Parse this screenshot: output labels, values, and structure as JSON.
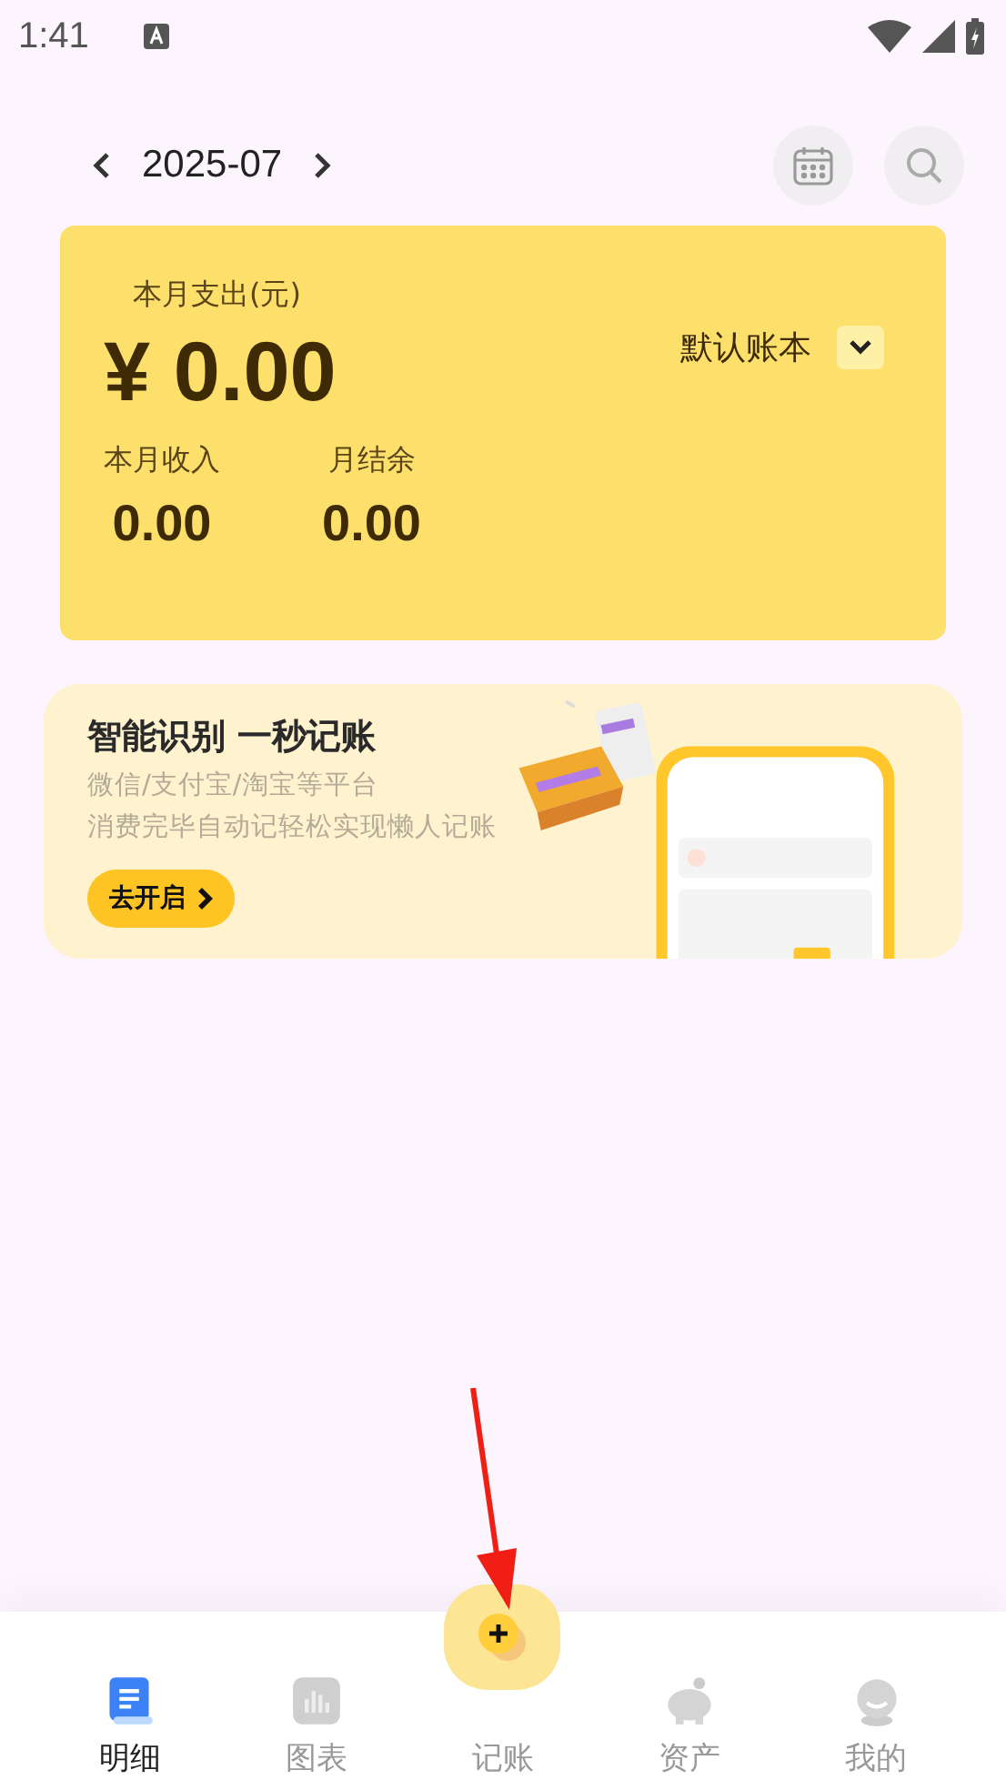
{
  "status_bar": {
    "time": "1:41"
  },
  "header": {
    "month": "2025-07"
  },
  "summary_card": {
    "expense_label": "本月支出(元)",
    "expense": "¥ 0.00",
    "book": "默认账本",
    "income_label": "本月收入",
    "income": "0.00",
    "balance_label": "月结余",
    "balance": "0.00"
  },
  "banner": {
    "title": "智能识别 一秒记账",
    "line_1": "微信/支付宝/淘宝等平台",
    "line_2": "消费完毕自动记轻松实现懒人记账",
    "button": "去开启",
    "kind": "picture"
  },
  "bottom_nav": [
    {
      "label": "明细",
      "kind": "list",
      "selected": true
    },
    {
      "label": "图表",
      "kind": "chart",
      "selected": false
    },
    {
      "label": "记账",
      "kind": "add",
      "selected": false
    },
    {
      "label": "资产",
      "kind": "piggy",
      "selected": false
    },
    {
      "label": "我的",
      "kind": "user",
      "selected": false
    }
  ]
}
